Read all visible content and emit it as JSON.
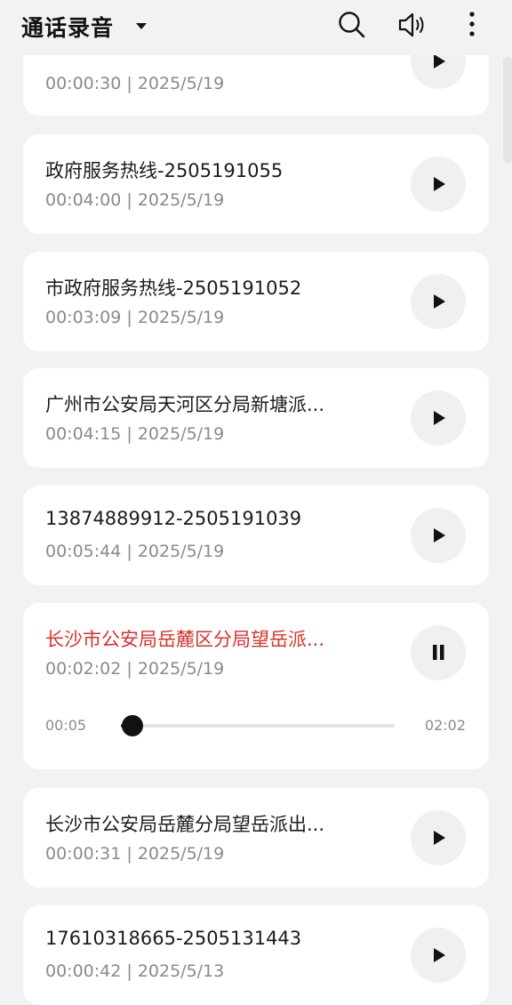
{
  "header": {
    "title": "通话录音",
    "icons": [
      "chevron-down-icon",
      "search-icon",
      "speaker-icon",
      "more-vert-icon"
    ]
  },
  "recordings": [
    {
      "name": "",
      "meta": "00:00:30 | 2025/5/19"
    },
    {
      "name": "政府服务热线-2505191055",
      "meta": "00:04:00 | 2025/5/19"
    },
    {
      "name": "市政府服务热线-2505191052",
      "meta": "00:03:09 | 2025/5/19"
    },
    {
      "name": "广州市公安局天河区分局新塘派...",
      "meta": "00:04:15 | 2025/5/19"
    },
    {
      "name": "13874889912-2505191039",
      "meta": "00:05:44 | 2025/5/19"
    },
    {
      "name": "长沙市公安局岳麓区分局望岳派...",
      "meta": "00:02:02 | 2025/5/19",
      "playing": true
    },
    {
      "name": "长沙市公安局岳麓分局望岳派出...",
      "meta": "00:00:31 | 2025/5/19"
    },
    {
      "name": "17610318665-2505131443",
      "meta": "00:00:42 | 2025/5/13"
    }
  ],
  "player": {
    "position": "00:05",
    "duration": "02:02",
    "progress": 0.041
  },
  "colors": {
    "active": "#d8322c",
    "background": "#f2f2f4",
    "card": "#ffffff"
  }
}
